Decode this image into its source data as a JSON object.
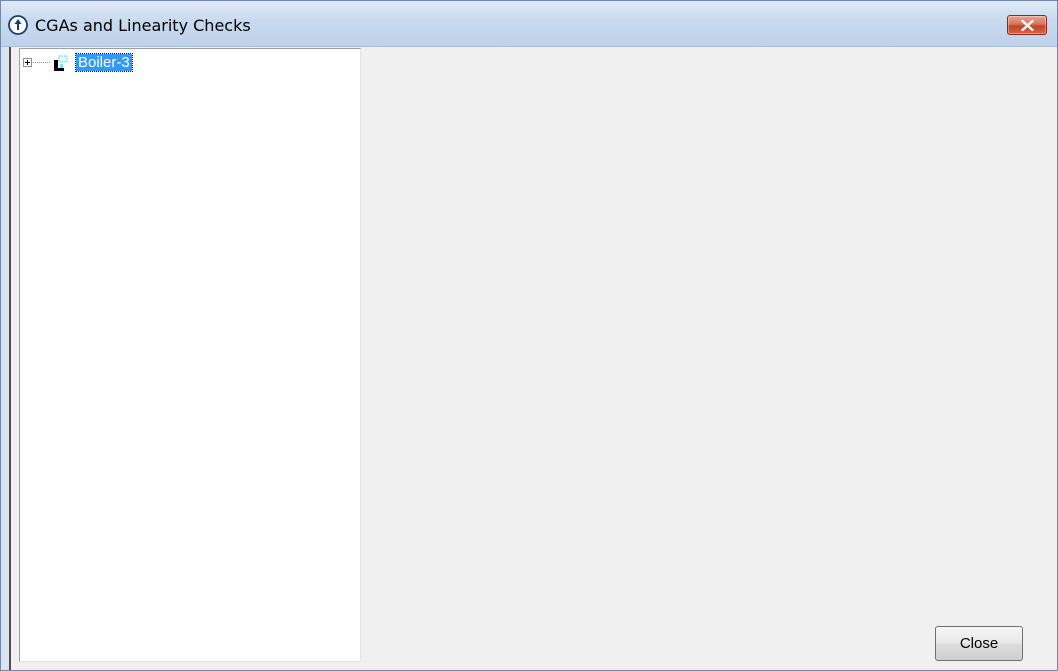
{
  "window": {
    "title": "CGAs and Linearity Checks",
    "app_icon": "app-logo-icon",
    "close_icon": "close-icon"
  },
  "tree": {
    "nodes": [
      {
        "label": "Boiler-3",
        "expanded": false,
        "selected": true,
        "icon": "boiler-unit-icon"
      }
    ]
  },
  "buttons": {
    "close_label": "Close"
  },
  "colors": {
    "selection": "#3399ff",
    "titlebar": "#c9daee",
    "close_button_red": "#c2452a",
    "panel_background": "#f0f0f0"
  }
}
